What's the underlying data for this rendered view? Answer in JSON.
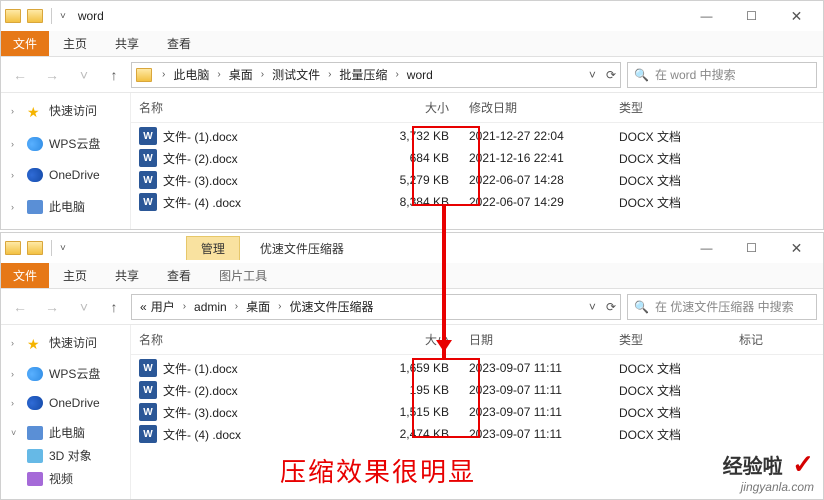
{
  "window1": {
    "title": "word",
    "menu": {
      "file": "文件",
      "home": "主页",
      "share": "共享",
      "view": "查看"
    },
    "crumbs": [
      "此电脑",
      "桌面",
      "测试文件",
      "批量压缩",
      "word"
    ],
    "search_placeholder": "在 word 中搜索",
    "headers": {
      "name": "名称",
      "size": "大小",
      "mod": "修改日期",
      "type": "类型"
    },
    "rows": [
      {
        "name": "文件- (1).docx",
        "size": "3,732 KB",
        "date": "2021-12-27 22:04",
        "type": "DOCX 文档"
      },
      {
        "name": "文件- (2).docx",
        "size": "684 KB",
        "date": "2021-12-16 22:41",
        "type": "DOCX 文档"
      },
      {
        "name": "文件- (3).docx",
        "size": "5,279 KB",
        "date": "2022-06-07 14:28",
        "type": "DOCX 文档"
      },
      {
        "name": "文件- (4) .docx",
        "size": "8,384 KB",
        "date": "2022-06-07 14:29",
        "type": "DOCX 文档"
      }
    ]
  },
  "window2": {
    "ribbon_context": "管理",
    "title": "优速文件压缩器",
    "menu": {
      "file": "文件",
      "home": "主页",
      "share": "共享",
      "view": "查看",
      "picture_tools": "图片工具"
    },
    "crumbs": [
      "用户",
      "admin",
      "桌面",
      "优速文件压缩器"
    ],
    "search_placeholder": "在 优速文件压缩器 中搜索",
    "headers": {
      "name": "名称",
      "size": "大小",
      "date": "日期",
      "type": "类型",
      "mark": "标记"
    },
    "rows": [
      {
        "name": "文件- (1).docx",
        "size": "1,659 KB",
        "date": "2023-09-07 11:11",
        "type": "DOCX 文档"
      },
      {
        "name": "文件- (2).docx",
        "size": "195 KB",
        "date": "2023-09-07 11:11",
        "type": "DOCX 文档"
      },
      {
        "name": "文件- (3).docx",
        "size": "1,515 KB",
        "date": "2023-09-07 11:11",
        "type": "DOCX 文档"
      },
      {
        "name": "文件- (4) .docx",
        "size": "2,474 KB",
        "date": "2023-09-07 11:11",
        "type": "DOCX 文档"
      }
    ]
  },
  "sidebar": {
    "quick_access": "快速访问",
    "wps_cloud": "WPS云盘",
    "onedrive": "OneDrive",
    "this_pc": "此电脑",
    "objects_3d": "3D 对象",
    "videos": "视频"
  },
  "annotation": {
    "caption": "压缩效果很明显",
    "watermark_l1": "经验啦",
    "watermark_check": "✓",
    "watermark_l2": "jingyanla.com"
  },
  "icons": {
    "minimize": "—",
    "maximize": "☐",
    "close": "✕",
    "back": "←",
    "forward": "→",
    "up": "↑",
    "dropdown": "˅",
    "refresh": "⟳",
    "search": "🔍",
    "caret": "›",
    "expand": "›",
    "collapse": "˅",
    "word_letter": "W"
  }
}
